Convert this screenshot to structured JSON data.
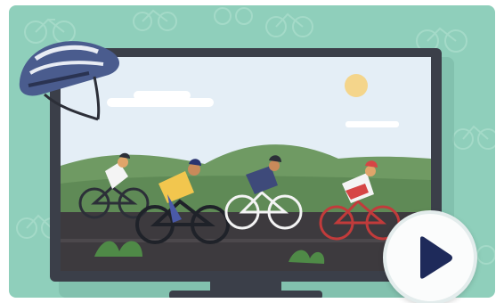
{
  "illustration": {
    "subject": "road-cycling-race-on-monitor",
    "icons": [
      "bicycle-pattern-icon",
      "helmet-icon",
      "monitor-icon",
      "sun-icon",
      "cloud-icon",
      "cyclist-icon"
    ]
  },
  "controls": {
    "play_icon": "play-icon"
  },
  "colors": {
    "background": "#8fcfbb",
    "monitor_frame": "#3b3f49",
    "sky": "#e4eef6",
    "hill": "#6f9a63",
    "road": "#3d3a3e",
    "sun": "#f4d58b",
    "play_triangle": "#1e2a5a"
  }
}
